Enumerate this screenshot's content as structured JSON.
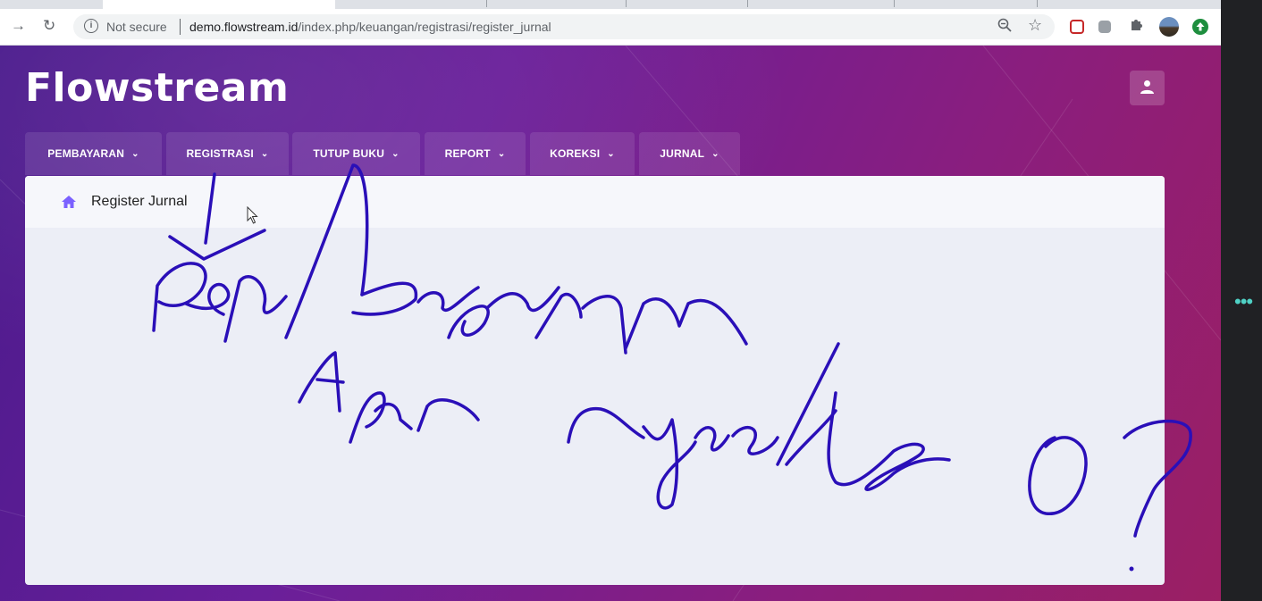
{
  "browser": {
    "security_label": "Not secure",
    "url_host": "demo.flowstream.id",
    "url_path": "/index.php/keuangan/registrasi/register_jurnal",
    "icons": [
      "back-icon",
      "reload-icon",
      "info-icon",
      "zoom-icon",
      "star-icon",
      "extension-icon",
      "profile-avatar",
      "update-icon"
    ]
  },
  "app": {
    "brand": "Flowstream",
    "user_icon": "user-icon"
  },
  "nav": {
    "items": [
      {
        "label": "PEMBAYARAN"
      },
      {
        "label": "REGISTRASI"
      },
      {
        "label": "TUTUP BUKU"
      },
      {
        "label": "REPORT"
      },
      {
        "label": "KOREKSI"
      },
      {
        "label": "JURNAL"
      }
    ],
    "chevron": "⌄"
  },
  "page": {
    "title": "Register Jurnal",
    "title_icon": "home-icon"
  },
  "annotation": {
    "handwriting": "Pembayaran Agar Register 0?",
    "ink_color": "#2a0fb8"
  },
  "colors": {
    "bg_purple": "#6a1f9a",
    "bg_magenta": "#9b1f63",
    "accent_icon": "#7b61ff"
  }
}
